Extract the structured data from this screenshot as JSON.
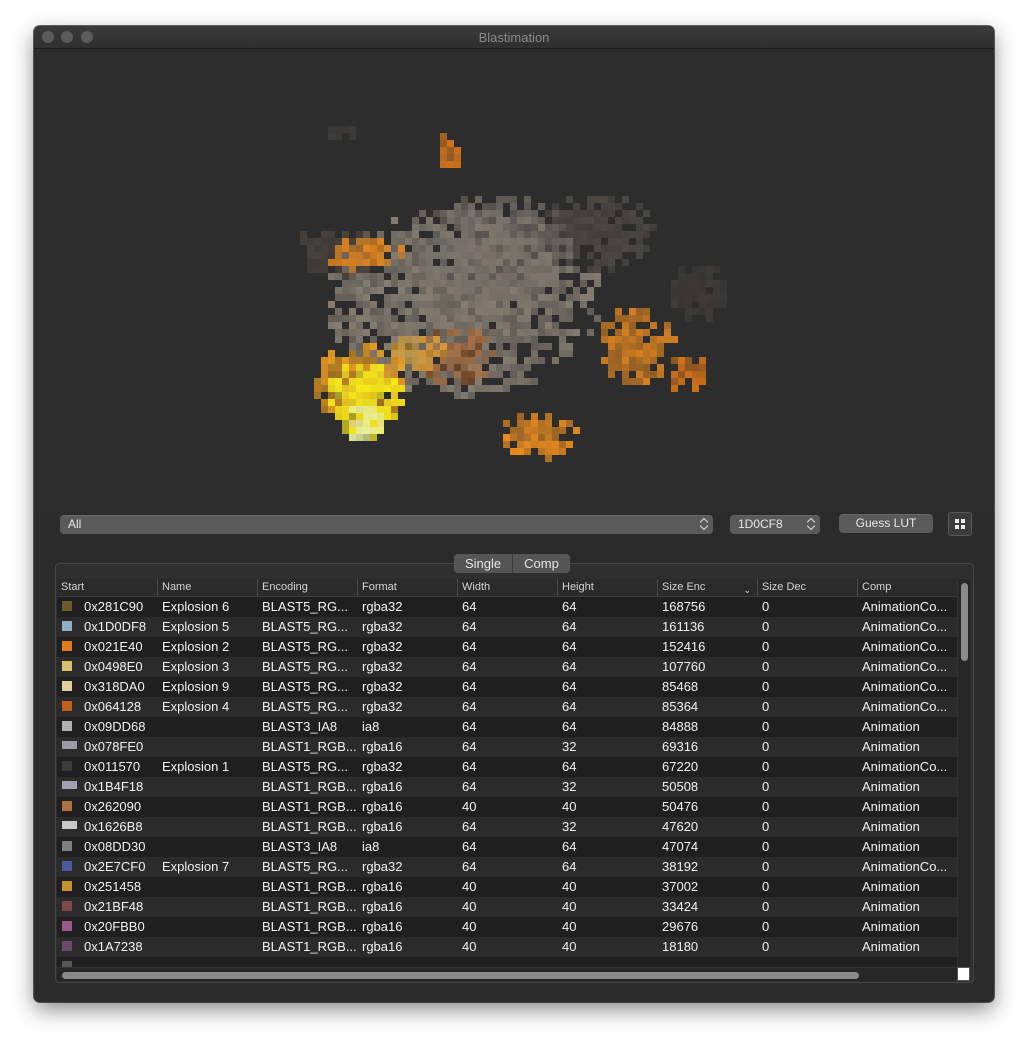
{
  "window": {
    "title": "Blastimation"
  },
  "controls": {
    "filter_value": "All",
    "address_value": "1D0CF8",
    "guess_lut_label": "Guess LUT",
    "grid_icon": "grid-icon"
  },
  "segmented": {
    "single_label": "Single",
    "comp_label": "Comp",
    "selected": "none"
  },
  "table": {
    "columns": [
      "Start",
      "Name",
      "Encoding",
      "Format",
      "Width",
      "Height",
      "Size Enc",
      "Size Dec",
      "Comp"
    ],
    "sorted_column": "Size Enc",
    "selected_row": 1,
    "rows": [
      {
        "start": "0x281C90",
        "name": "Explosion 6",
        "encoding": "BLAST5_RG...",
        "format": "rgba32",
        "width": "64",
        "height": "64",
        "size_enc": "168756",
        "size_dec": "0",
        "comp": "AnimationCo...",
        "thumb": "#6b5a2e"
      },
      {
        "start": "0x1D0DF8",
        "name": "Explosion 5",
        "encoding": "BLAST5_RG...",
        "format": "rgba32",
        "width": "64",
        "height": "64",
        "size_enc": "161136",
        "size_dec": "0",
        "comp": "AnimationCo...",
        "thumb": "#8fb0c8"
      },
      {
        "start": "0x021E40",
        "name": "Explosion 2",
        "encoding": "BLAST5_RG...",
        "format": "rgba32",
        "width": "64",
        "height": "64",
        "size_enc": "152416",
        "size_dec": "0",
        "comp": "AnimationCo...",
        "thumb": "#e07a20"
      },
      {
        "start": "0x0498E0",
        "name": "Explosion 3",
        "encoding": "BLAST5_RG...",
        "format": "rgba32",
        "width": "64",
        "height": "64",
        "size_enc": "107760",
        "size_dec": "0",
        "comp": "AnimationCo...",
        "thumb": "#d8c070"
      },
      {
        "start": "0x318DA0",
        "name": "Explosion 9",
        "encoding": "BLAST5_RG...",
        "format": "rgba32",
        "width": "64",
        "height": "64",
        "size_enc": "85468",
        "size_dec": "0",
        "comp": "AnimationCo...",
        "thumb": "#e0d0a0"
      },
      {
        "start": "0x064128",
        "name": "Explosion 4",
        "encoding": "BLAST5_RG...",
        "format": "rgba32",
        "width": "64",
        "height": "64",
        "size_enc": "85364",
        "size_dec": "0",
        "comp": "AnimationCo...",
        "thumb": "#c06020"
      },
      {
        "start": "0x09DD68",
        "name": "",
        "encoding": "BLAST3_IA8",
        "format": "ia8",
        "width": "64",
        "height": "64",
        "size_enc": "84888",
        "size_dec": "0",
        "comp": "Animation",
        "thumb": "#b0b0b0"
      },
      {
        "start": "0x078FE0",
        "name": "",
        "encoding": "BLAST1_RGB...",
        "format": "rgba16",
        "width": "64",
        "height": "32",
        "size_enc": "69316",
        "size_dec": "0",
        "comp": "Animation",
        "thumb": "#9a9aa8"
      },
      {
        "start": "0x011570",
        "name": "Explosion 1",
        "encoding": "BLAST5_RG...",
        "format": "rgba32",
        "width": "64",
        "height": "64",
        "size_enc": "67220",
        "size_dec": "0",
        "comp": "AnimationCo...",
        "thumb": "#3a3a3a"
      },
      {
        "start": "0x1B4F18",
        "name": "",
        "encoding": "BLAST1_RGB...",
        "format": "rgba16",
        "width": "64",
        "height": "32",
        "size_enc": "50508",
        "size_dec": "0",
        "comp": "Animation",
        "thumb": "#a0a0b0"
      },
      {
        "start": "0x262090",
        "name": "",
        "encoding": "BLAST1_RGB...",
        "format": "rgba16",
        "width": "40",
        "height": "40",
        "size_enc": "50476",
        "size_dec": "0",
        "comp": "Animation",
        "thumb": "#b07040"
      },
      {
        "start": "0x1626B8",
        "name": "",
        "encoding": "BLAST1_RGB...",
        "format": "rgba16",
        "width": "64",
        "height": "32",
        "size_enc": "47620",
        "size_dec": "0",
        "comp": "Animation",
        "thumb": "#c8c8c8"
      },
      {
        "start": "0x08DD30",
        "name": "",
        "encoding": "BLAST3_IA8",
        "format": "ia8",
        "width": "64",
        "height": "64",
        "size_enc": "47074",
        "size_dec": "0",
        "comp": "Animation",
        "thumb": "#808080"
      },
      {
        "start": "0x2E7CF0",
        "name": "Explosion 7",
        "encoding": "BLAST5_RG...",
        "format": "rgba32",
        "width": "64",
        "height": "64",
        "size_enc": "38192",
        "size_dec": "0",
        "comp": "AnimationCo...",
        "thumb": "#4a5a9a"
      },
      {
        "start": "0x251458",
        "name": "",
        "encoding": "BLAST1_RGB...",
        "format": "rgba16",
        "width": "40",
        "height": "40",
        "size_enc": "37002",
        "size_dec": "0",
        "comp": "Animation",
        "thumb": "#c89030"
      },
      {
        "start": "0x21BF48",
        "name": "",
        "encoding": "BLAST1_RGB...",
        "format": "rgba16",
        "width": "40",
        "height": "40",
        "size_enc": "33424",
        "size_dec": "0",
        "comp": "Animation",
        "thumb": "#7a4a4a"
      },
      {
        "start": "0x20FBB0",
        "name": "",
        "encoding": "BLAST1_RGB...",
        "format": "rgba16",
        "width": "40",
        "height": "40",
        "size_enc": "29676",
        "size_dec": "0",
        "comp": "Animation",
        "thumb": "#9a5a8a"
      },
      {
        "start": "0x1A7238",
        "name": "",
        "encoding": "BLAST1_RGB...",
        "format": "rgba16",
        "width": "40",
        "height": "40",
        "size_enc": "18180",
        "size_dec": "0",
        "comp": "Animation",
        "thumb": "#6a4a6a"
      }
    ]
  },
  "colors": {
    "window_bg": "#2b2b2b",
    "fire_yellow": "#f4e81c",
    "fire_orange": "#f09020",
    "smoke_gray": "#8a8276"
  }
}
